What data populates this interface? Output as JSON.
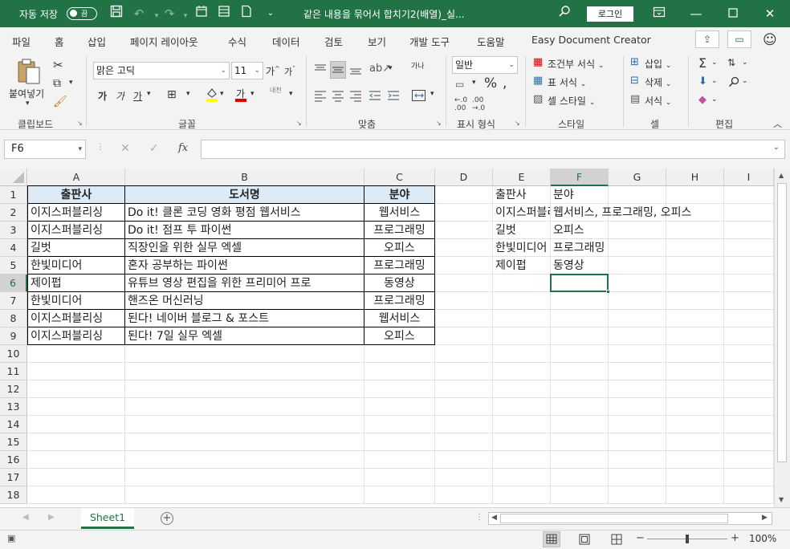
{
  "titlebar": {
    "autosave_label": "자동 저장",
    "autosave_state": "끔",
    "doc_title": "같은 내용을 묶어서 합치기2(배열)_실...",
    "login_label": "로그인"
  },
  "tabs": [
    "파일",
    "홈",
    "삽입",
    "페이지 레이아웃",
    "수식",
    "데이터",
    "검토",
    "보기",
    "개발 도구",
    "도움말",
    "Easy Document Creator"
  ],
  "active_tab": "홈",
  "ribbon": {
    "clipboard": {
      "paste_label": "붙여넣기",
      "group_label": "클립보드"
    },
    "font": {
      "font_name": "맑은 고딕",
      "font_size": "11",
      "bold": "가",
      "italic": "가",
      "underline": "가",
      "font_color_glyph": "가",
      "phonetic": "내천",
      "grow": "가",
      "shrink": "가",
      "group_label": "글꼴"
    },
    "alignment": {
      "wrap": "가나",
      "group_label": "맞춤"
    },
    "number": {
      "format": "일반",
      "group_label": "표시 형식"
    },
    "styles": {
      "conditional": "조건부 서식",
      "table": "표 서식",
      "cell": "셀 스타일",
      "group_label": "스타일"
    },
    "cells": {
      "insert": "삽입",
      "delete": "삭제",
      "format": "서식",
      "group_label": "셀"
    },
    "editing": {
      "group_label": "편집"
    }
  },
  "formula_bar": {
    "name_box": "F6",
    "formula": "",
    "fx": "fx"
  },
  "columns": [
    "A",
    "B",
    "C",
    "D",
    "E",
    "F",
    "G",
    "H",
    "I"
  ],
  "selected_column": "F",
  "rows": [
    "1",
    "2",
    "3",
    "4",
    "5",
    "6",
    "7",
    "8",
    "9",
    "10",
    "11",
    "12",
    "13",
    "14",
    "15",
    "16",
    "17",
    "18"
  ],
  "selected_row": "6",
  "table": {
    "headers": [
      "출판사",
      "도서명",
      "분야"
    ],
    "rows": [
      [
        "이지스퍼블리싱",
        "Do it! 클론 코딩 영화 평점 웹서비스",
        "웹서비스"
      ],
      [
        "이지스퍼블리싱",
        "Do it! 점프 투 파이썬",
        "프로그래밍"
      ],
      [
        "길벗",
        "직장인을 위한 실무 엑셀",
        "오피스"
      ],
      [
        "한빛미디어",
        "혼자 공부하는 파이썬",
        "프로그래밍"
      ],
      [
        "제이펍",
        "유튜브 영상 편집을 위한 프리미어 프로",
        "동영상"
      ],
      [
        "한빛미디어",
        "핸즈온 머신러닝",
        "프로그래밍"
      ],
      [
        "이지스퍼블리싱",
        "된다! 네이버 블로그 & 포스트",
        "웹서비스"
      ],
      [
        "이지스퍼블리싱",
        "된다! 7일 실무 엑셀",
        "오피스"
      ]
    ]
  },
  "result": {
    "headers": [
      "출판사",
      "분야"
    ],
    "rows": [
      [
        "이지스퍼블리싱",
        "웹서비스, 프로그래밍, 오피스"
      ],
      [
        "길벗",
        "오피스"
      ],
      [
        "한빛미디어",
        "프로그래밍"
      ],
      [
        "제이펍",
        "동영상"
      ]
    ]
  },
  "sheet_tab": "Sheet1",
  "status": {
    "zoom": "100%"
  },
  "colors": {
    "brand": "#217346",
    "header_fill": "#ddebf7"
  }
}
